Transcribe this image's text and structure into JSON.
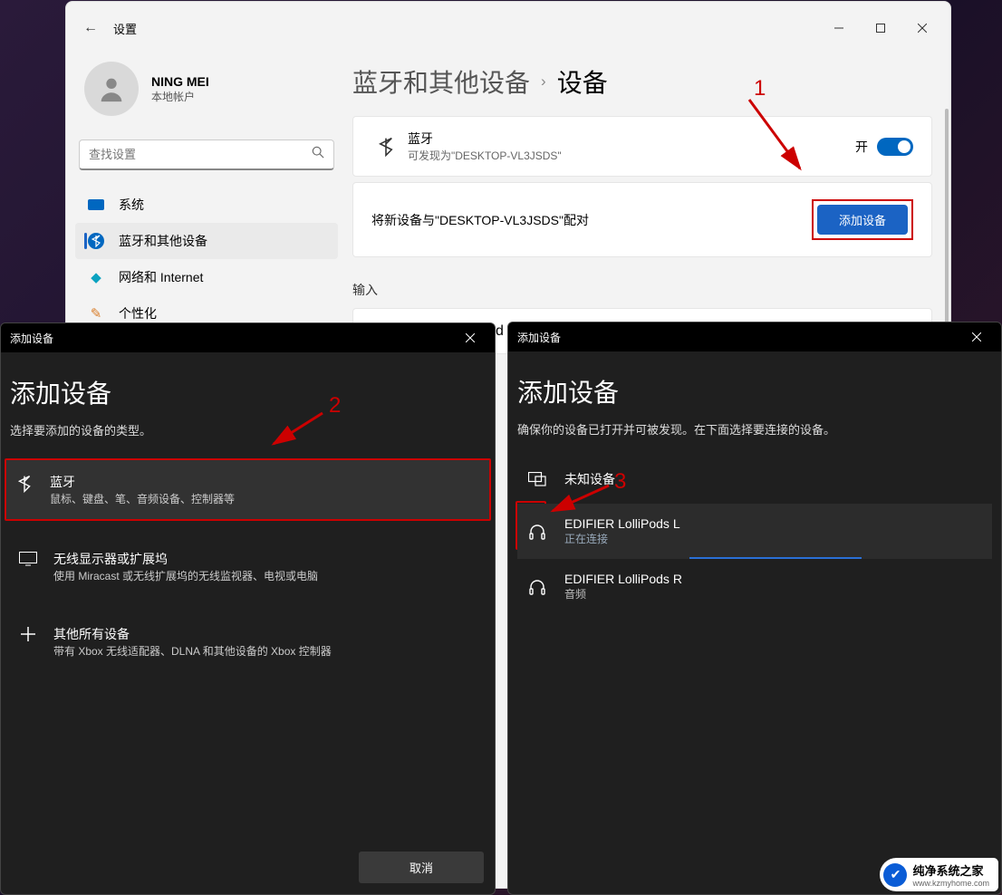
{
  "window": {
    "title": "设置"
  },
  "user": {
    "name": "NING MEI",
    "sub": "本地帐户"
  },
  "search": {
    "placeholder": "查找设置"
  },
  "nav": {
    "system": "系统",
    "bluetooth": "蓝牙和其他设备",
    "network": "网络和 Internet",
    "personalize": "个性化"
  },
  "breadcrumb": {
    "parent": "蓝牙和其他设备",
    "sep": "›",
    "current": "设备"
  },
  "bluetooth_card": {
    "title": "蓝牙",
    "sub": "可发现为\"DESKTOP-VL3JSDS\"",
    "toggle_label": "开"
  },
  "pair_row": {
    "text": "将新设备与\"DESKTOP-VL3JSDS\"配对",
    "button": "添加设备"
  },
  "input_section": {
    "heading": "输入",
    "device": "USB Keyboard"
  },
  "annotations": {
    "one": "1",
    "two": "2",
    "three": "3"
  },
  "dialog1": {
    "titlebar": "添加设备",
    "heading": "添加设备",
    "sub": "选择要添加的设备的类型。",
    "opt_bt_title": "蓝牙",
    "opt_bt_desc": "鼠标、键盘、笔、音频设备、控制器等",
    "opt_wd_title": "无线显示器或扩展坞",
    "opt_wd_desc": "使用 Miracast 或无线扩展坞的无线监视器、电视或电脑",
    "opt_other_title": "其他所有设备",
    "opt_other_desc": "带有 Xbox 无线适配器、DLNA 和其他设备的 Xbox 控制器",
    "cancel": "取消"
  },
  "dialog2": {
    "titlebar": "添加设备",
    "heading": "添加设备",
    "sub": "确保你的设备已打开并可被发现。在下面选择要连接的设备。",
    "unknown": "未知设备",
    "dev1_name": "EDIFIER LolliPods L",
    "dev1_status": "正在连接",
    "dev2_name": "EDIFIER LolliPods R",
    "dev2_status": "音频"
  },
  "watermark": {
    "title": "纯净系统之家",
    "url": "www.kzmyhome.com"
  }
}
